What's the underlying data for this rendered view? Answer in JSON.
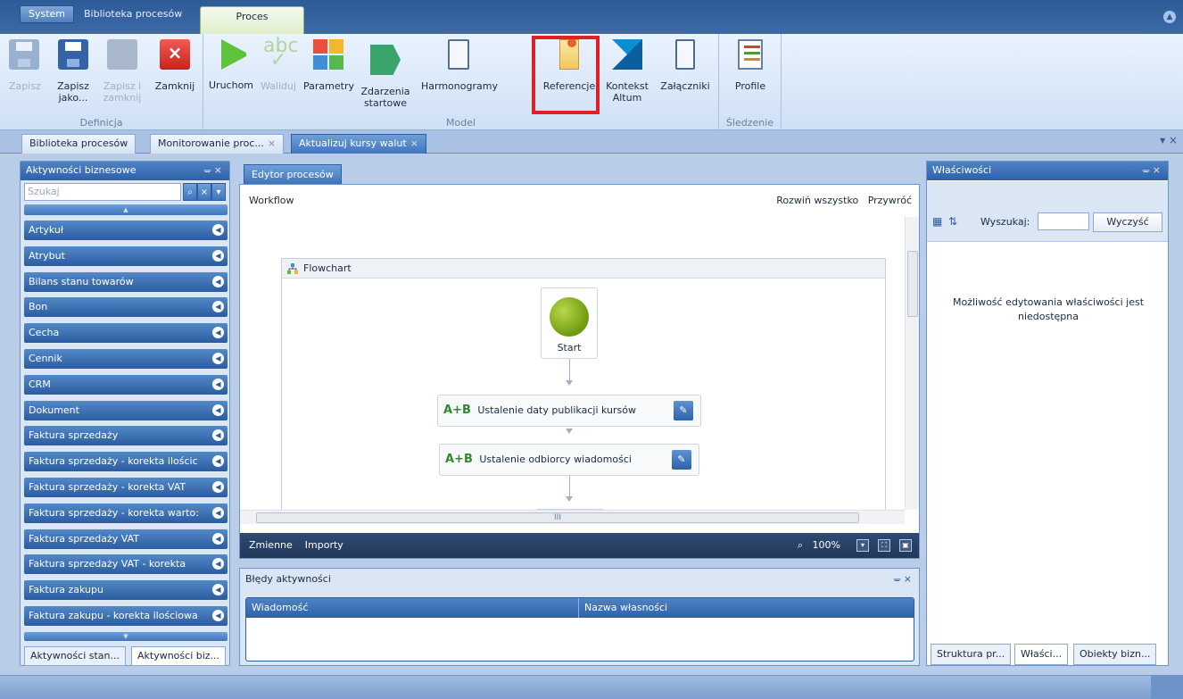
{
  "menu": {
    "system": "System",
    "library": "Biblioteka procesów",
    "process": "Proces"
  },
  "ribbon": {
    "groups": {
      "definition": "Definicja",
      "model": "Model",
      "tracking": "Śledzenie"
    },
    "save": "Zapisz",
    "save_as": [
      "Zapisz",
      "jako..."
    ],
    "save_close": [
      "Zapisz i",
      "zamknij"
    ],
    "close": "Zamknij",
    "run": "Uruchom",
    "validate": "Waliduj",
    "validate_icon_text": "abc",
    "parameters": "Parametry",
    "start_events": [
      "Zdarzenia",
      "startowe"
    ],
    "schedules": "Harmonogramy",
    "references": "Referencje",
    "altum_context": [
      "Kontekst",
      "Altum"
    ],
    "attachments": "Załączniki",
    "profile": "Profile"
  },
  "doc_tabs": {
    "tab1": "Biblioteka procesów",
    "tab2": "Monitorowanie proc...",
    "tab3": "Aktualizuj kursy walut",
    "close": "×",
    "controls": "▾ ×"
  },
  "left_panel": {
    "title": "Aktywności biznesowe",
    "pin": "ᚚ ×",
    "search_placeholder": "Szukaj",
    "categories": [
      "Artykuł",
      "Atrybut",
      "Bilans stanu towarów",
      "Bon",
      "Cecha",
      "Cennik",
      "CRM",
      "Dokument",
      "Faktura sprzedaży",
      "Faktura sprzedaży - korekta ilościc",
      "Faktura sprzedaży - korekta VAT",
      "Faktura sprzedaży - korekta warto:",
      "Faktura sprzedaży VAT",
      "Faktura sprzedaży VAT - korekta",
      "Faktura zakupu",
      "Faktura zakupu - korekta ilościowa"
    ],
    "bottom_tabs": [
      "Aktywności stan...",
      "Aktywności biz..."
    ]
  },
  "editor": {
    "tab": "Edytor procesów",
    "workflow": "Workflow",
    "expand_all": "Rozwiń wszystko",
    "restore": "Przywróć",
    "flowchart": "Flowchart",
    "start": "Start",
    "activity_prefix": "A+B",
    "activities": [
      "Ustalenie daty publikacji kursów",
      "Ustalenie odbiorcy wiadomości"
    ],
    "hscroll_grip": "III",
    "variables": "Zmienne",
    "imports": "Importy",
    "zoom": "100%"
  },
  "errors": {
    "title": "Błędy aktywności",
    "pin": "ᚚ ×",
    "col_message": "Wiadomość",
    "col_property": "Nazwa własności"
  },
  "right_panel": {
    "title": "Właściwości",
    "pin": "ᚚ ×",
    "search_label": "Wyszukaj:",
    "clear": "Wyczyść",
    "message": "Możliwość edytowania właściwości jest niedostępna",
    "bottom_tabs": [
      "Struktura pr...",
      "Właści...",
      "Obiekty bizn..."
    ]
  }
}
